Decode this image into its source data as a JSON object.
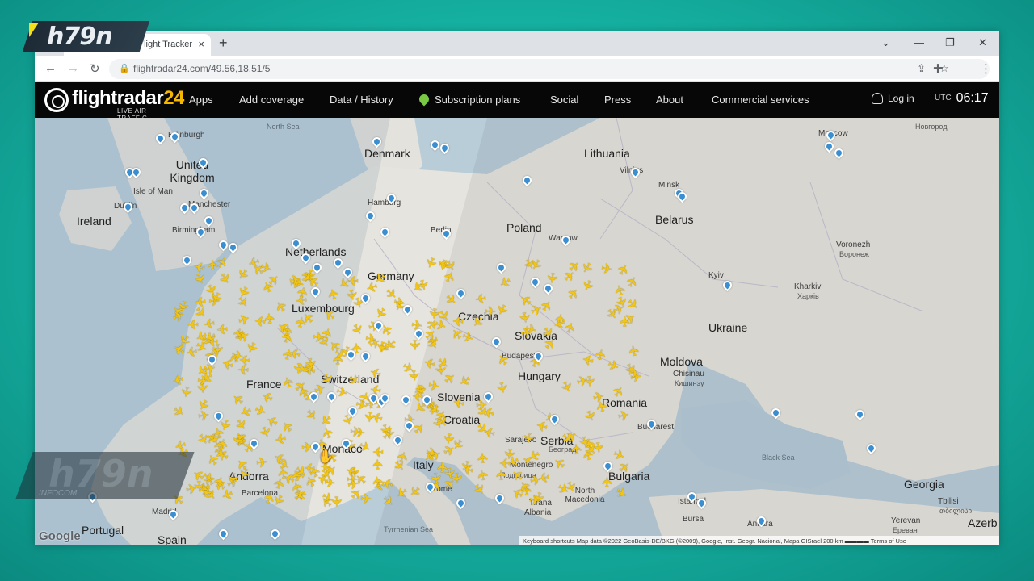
{
  "overlay": {
    "brand_text": "h79n",
    "watermark_text": "h79n",
    "watermark_sub": "INFOCOM"
  },
  "browser": {
    "tab_title": "…ar24: Live Flight Tracker",
    "tab_close": "×",
    "new_tab": "+",
    "window_controls": [
      "⌄",
      "—",
      "❐",
      "✕"
    ],
    "url": "flightradar24.com/49.56,18.51/5"
  },
  "header": {
    "logo_name": "flightradar",
    "logo_number": "24",
    "logo_tagline": "LIVE AIR TRAFFIC",
    "nav": [
      "Apps",
      "Add coverage",
      "Data / History",
      "Subscription plans",
      "Social",
      "Press",
      "About",
      "Commercial services"
    ],
    "login": "Log in",
    "utc_label": "UTC",
    "time": "06:17"
  },
  "map": {
    "countries": [
      "United Kingdom",
      "Ireland",
      "Denmark",
      "Lithuania",
      "Belarus",
      "Poland",
      "Netherlands",
      "Germany",
      "Luxembourg",
      "Czechia",
      "Slovakia",
      "Ukraine",
      "Moldova",
      "Hungary",
      "France",
      "Switzerland",
      "Slovenia",
      "Croatia",
      "Romania",
      "Serbia",
      "Italy",
      "Monaco",
      "Andorra",
      "Bulgaria",
      "Georgia",
      "Spain",
      "Portugal",
      "North Macedonia",
      "Albania",
      "Azerb"
    ],
    "cities": [
      "Edinburgh",
      "Isle of Man",
      "Dublin",
      "Manchester",
      "Birmingham",
      "Hamburg",
      "Berlin",
      "Warsaw",
      "Minsk",
      "Vilnius",
      "Kyiv",
      "Kharkiv",
      "Voronezh",
      "Moscow",
      "Budapest",
      "Chisinau",
      "Bucharest",
      "Sarajevo",
      "Montenegro",
      "Rome",
      "Tirana",
      "Istanbul",
      "Bursa",
      "Ankara",
      "Tbilisi",
      "Yerevan",
      "Madrid",
      "Barcelona"
    ],
    "cyrillic": [
      "Новгород",
      "Воронеж",
      "Харків",
      "Кишинэу",
      "Подгорица",
      "Београд",
      "თბილისი",
      "Ереван"
    ],
    "seas": [
      "North Sea",
      "Black Sea",
      "Tyrrhenian Sea"
    ],
    "footer": "Keyboard shortcuts   Map data ©2022 GeoBasis-DE/BKG (©2009), Google, Inst. Geogr. Nacional, Mapa GISrael   200 km ▬▬▬▬   Terms of Use",
    "google": "Google"
  }
}
